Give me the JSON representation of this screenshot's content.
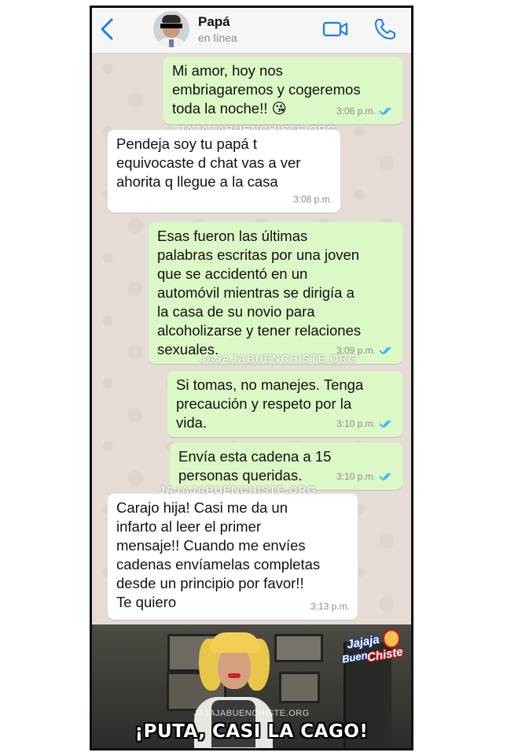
{
  "header": {
    "contact_name": "Papá",
    "status": "en línea",
    "icons": [
      "back-chevron-icon",
      "video-call-icon",
      "phone-icon"
    ],
    "accent_color": "#1a7cf0"
  },
  "messages": [
    {
      "direction": "out",
      "text": "Mi amor, hoy nos\nembriagaremos y cogeremos\ntoda la noche!! 😘",
      "time": "3:06 p.m.",
      "read": true
    },
    {
      "direction": "in",
      "text": "Pendeja soy tu papá t\nequivocaste d chat vas a ver\nahorita q llegue a la casa",
      "time": "3:08 p.m."
    },
    {
      "direction": "out",
      "text": "Esas fueron las últimas\npalabras escritas por una joven\nque se accidentó en un\nautomóvil mientras se dirigía a\nla casa de su novio para\nalcoholizarse y tener relaciones\nsexuales.",
      "time": "3:09 p.m.",
      "read": true
    },
    {
      "direction": "out",
      "text": "Si tomas, no manejes. Tenga\nprecaución y respeto por la\nvida.",
      "time": "3:10 p.m.",
      "read": true
    },
    {
      "direction": "out",
      "text": "Envía esta cadena a 15\npersonas queridas.",
      "time": "3:10 p.m.",
      "read": true
    },
    {
      "direction": "in",
      "text": "Carajo hija! Casi me da un\ninfarto al leer el primer\nmensaje!! Cuando me envíes\ncadenas envíamelas completas\ndesde un principio por favor!!\nTe quiero",
      "time": "3:13 p.m."
    }
  ],
  "watermark": "JAJAJABUENCHISTE.ORG",
  "meme": {
    "caption": "¡PUTA, CASI LA CAGO!",
    "watermark": "JAJAJABUENCHISTE.ORG",
    "logo_line1": "Jajaja",
    "logo_line2": "Buen",
    "logo_line3": "Chiste"
  },
  "colors": {
    "outgoing_bubble": "#dcf8c6",
    "incoming_bubble": "#ffffff",
    "chat_background": "#e5ddd5",
    "read_ticks": "#34b7f1"
  }
}
